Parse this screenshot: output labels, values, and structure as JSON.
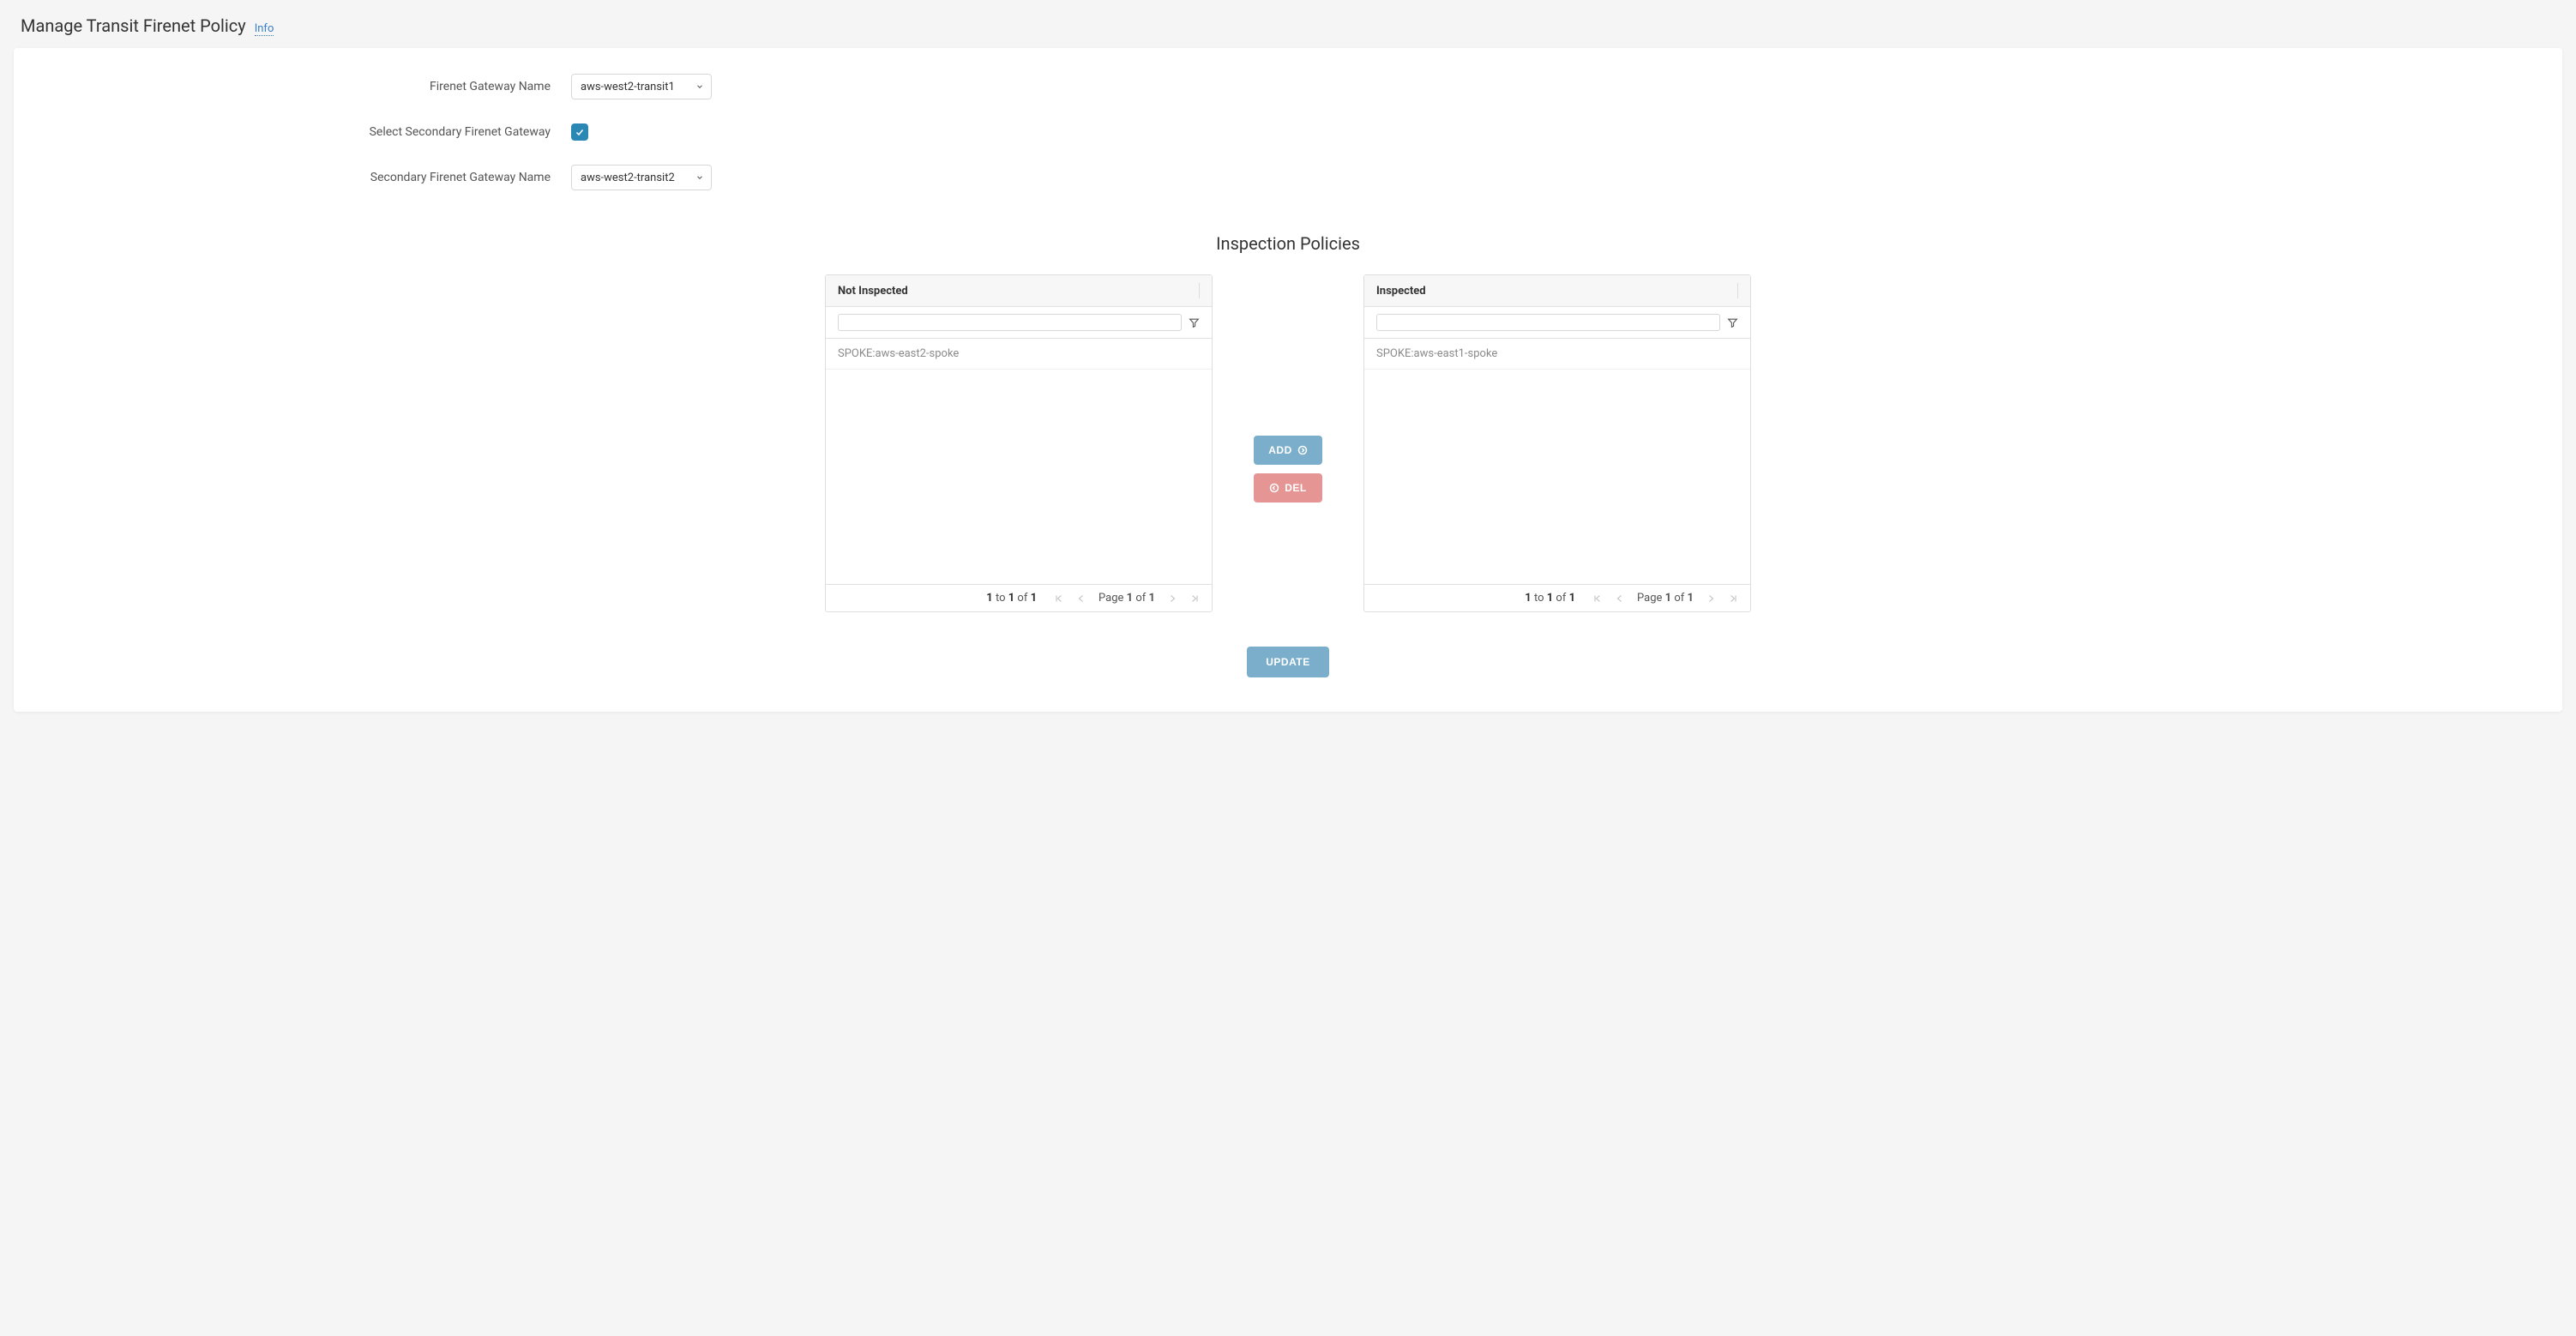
{
  "header": {
    "title": "Manage Transit Firenet Policy",
    "info_link": "Info"
  },
  "form": {
    "firenet_gateway": {
      "label": "Firenet Gateway Name",
      "value": "aws-west2-transit1"
    },
    "select_secondary": {
      "label": "Select Secondary Firenet Gateway",
      "checked": true
    },
    "secondary_gateway": {
      "label": "Secondary Firenet Gateway Name",
      "value": "aws-west2-transit2"
    }
  },
  "inspection": {
    "title": "Inspection Policies",
    "not_inspected": {
      "header": "Not Inspected",
      "rows": [
        "SPOKE:aws-east2-spoke"
      ],
      "pager": {
        "from": "1",
        "to": "1",
        "total": "1",
        "page": "1",
        "pages": "1"
      }
    },
    "inspected": {
      "header": "Inspected",
      "rows": [
        "SPOKE:aws-east1-spoke"
      ],
      "pager": {
        "from": "1",
        "to": "1",
        "total": "1",
        "page": "1",
        "pages": "1"
      }
    }
  },
  "actions": {
    "add": "ADD",
    "del": "DEL",
    "update": "UPDATE"
  },
  "labels": {
    "to": " to ",
    "of": " of ",
    "page": "Page "
  }
}
